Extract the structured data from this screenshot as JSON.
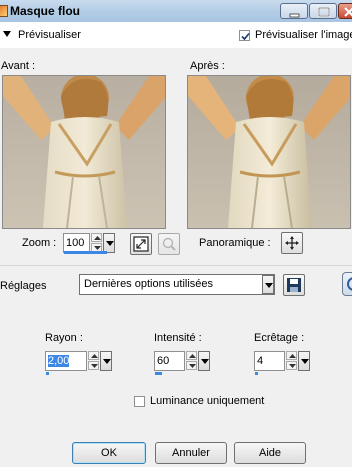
{
  "window": {
    "title": "Masque flou"
  },
  "preview": {
    "toggle_label": "Prévisualiser",
    "preview_image_label": "Prévisualiser l'image",
    "preview_image_checked": true
  },
  "panels": {
    "before_label": "Avant :",
    "after_label": "Après :"
  },
  "zoom": {
    "label": "Zoom :",
    "value": "100"
  },
  "pan": {
    "label": "Panoramique :"
  },
  "settings": {
    "label": "Réglages",
    "preset": "Dernières options utilisées"
  },
  "params": {
    "radius": {
      "label": "Rayon :",
      "value": "2,00"
    },
    "intensity": {
      "label": "Intensité :",
      "value": "60"
    },
    "clipping": {
      "label": "Ecrêtage :",
      "value": "4"
    }
  },
  "luminance": {
    "label": "Luminance uniquement",
    "checked": false
  },
  "buttons": {
    "ok": "OK",
    "cancel": "Annuler",
    "help": "Aide"
  },
  "colors": {
    "titlebar": "#b3cde6",
    "accent": "#3c86e6"
  }
}
